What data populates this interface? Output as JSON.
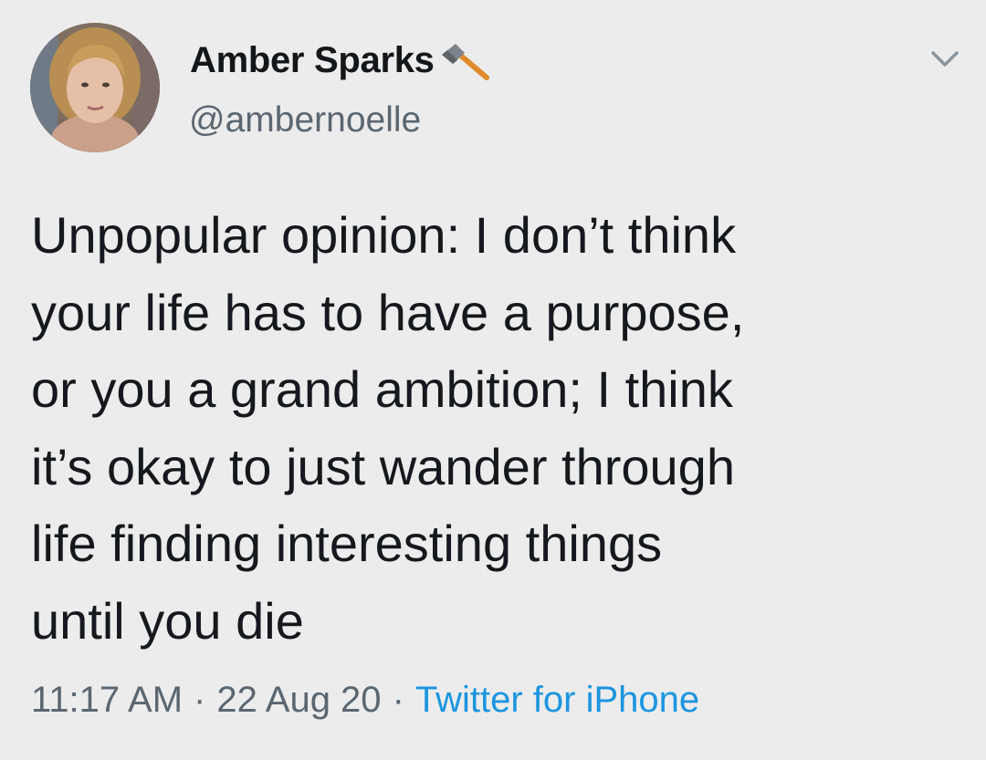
{
  "user": {
    "display_name": "Amber Sparks",
    "handle": "@ambernoelle",
    "name_emoji": "axe-icon"
  },
  "tweet": {
    "lines": [
      "Unpopular opinion: I don’t think",
      "your life has to have a purpose,",
      "or you a grand ambition; I think",
      "it’s okay to just wander through",
      "life finding interesting things",
      "until you die"
    ]
  },
  "meta": {
    "time": "11:17 AM",
    "separator": "·",
    "date": "22 Aug 20",
    "source": "Twitter for iPhone"
  },
  "colors": {
    "background": "#ececec",
    "text": "#15181c",
    "secondary": "#5b6670",
    "link": "#1b95e0"
  },
  "icons": {
    "menu": "chevron-down-icon"
  }
}
